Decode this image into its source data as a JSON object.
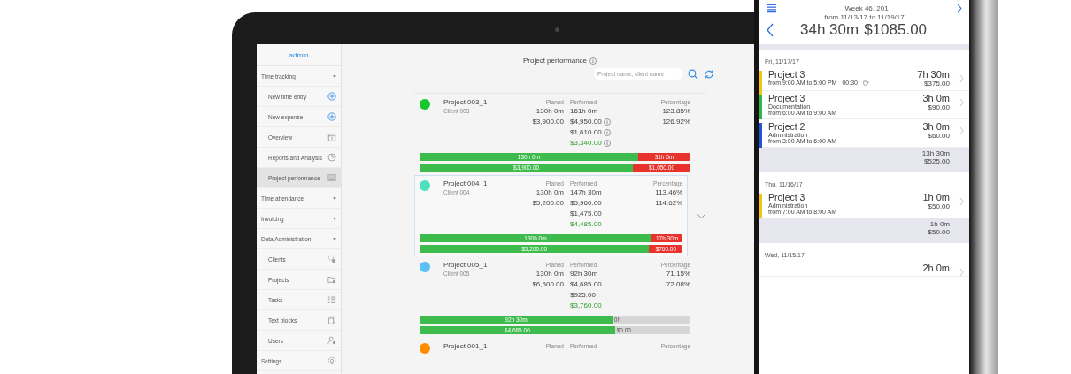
{
  "sidebar": {
    "user": "admin",
    "items": [
      {
        "label": "Time tracking",
        "kind": "group",
        "children": [
          {
            "label": "New time entry",
            "selected": false
          },
          {
            "label": "New expense",
            "selected": false
          },
          {
            "label": "Overview",
            "selected": false
          },
          {
            "label": "Reports and Analysis",
            "selected": false
          },
          {
            "label": "Project performance",
            "selected": true
          }
        ]
      },
      {
        "label": "Time attendance",
        "kind": "group"
      },
      {
        "label": "Invoicing",
        "kind": "group"
      },
      {
        "label": "Data Administration",
        "kind": "group",
        "children": [
          {
            "label": "Clients",
            "selected": false
          },
          {
            "label": "Projects",
            "selected": false
          },
          {
            "label": "Tasks",
            "selected": false
          },
          {
            "label": "Text blocks",
            "selected": false
          },
          {
            "label": "Users",
            "selected": false
          }
        ]
      },
      {
        "label": "Settings",
        "kind": "link"
      }
    ]
  },
  "main": {
    "title": "Project performance",
    "search": {
      "placeholder": "Project name, client name"
    },
    "projects": [
      {
        "name": "Project 003_1",
        "client": "Client 003",
        "color": "#16c72e",
        "selected": false,
        "headers": [
          "Planed",
          "Performed",
          "Percentage"
        ],
        "planned": [
          "130h 0m",
          "$3,900.00"
        ],
        "performed": [
          {
            "text": "161h 0m",
            "kind": "plain",
            "info": false
          },
          {
            "text": "$4,950.00",
            "kind": "plain",
            "info": true
          },
          {
            "text": "$1,610.00",
            "kind": "plain",
            "info": true
          },
          {
            "text": "$3,340.00",
            "kind": "profit",
            "info": true
          }
        ],
        "percentages": [
          "123.85%",
          "126.92%"
        ],
        "bars": [
          {
            "filled": "130h 0m",
            "rest": "31h 0m",
            "level": 0.807,
            "kind": "over"
          },
          {
            "filled": "$3,900.00",
            "rest": "$1,050.00",
            "level": 0.788,
            "kind": "over"
          }
        ]
      },
      {
        "name": "Project 004_1",
        "client": "Client 004",
        "color": "#4fe0c0",
        "selected": true,
        "headers": [
          "Planed",
          "Performed",
          "Percentage"
        ],
        "planned": [
          "130h 0m",
          "$5,200.00"
        ],
        "performed": [
          {
            "text": "147h 30m",
            "kind": "plain",
            "info": false
          },
          {
            "text": "$5,960.00",
            "kind": "plain",
            "info": false
          },
          {
            "text": "$1,475.00",
            "kind": "plain",
            "info": false
          },
          {
            "text": "$4,485.00",
            "kind": "profit",
            "info": false
          }
        ],
        "percentages": [
          "113.46%",
          "114.62%"
        ],
        "bars": [
          {
            "filled": "130h 0m",
            "rest": "17h 30m",
            "level": 0.881,
            "kind": "over"
          },
          {
            "filled": "$5,200.00",
            "rest": "$760.00",
            "level": 0.872,
            "kind": "over"
          }
        ]
      },
      {
        "name": "Project 005_1",
        "client": "Client 005",
        "color": "#5bc0f5",
        "selected": false,
        "headers": [
          "Planed",
          "Performed",
          "Percentage"
        ],
        "planned": [
          "130h 0m",
          "$6,500.00"
        ],
        "performed": [
          {
            "text": "92h 30m",
            "kind": "plain",
            "info": false
          },
          {
            "text": "$4,685.00",
            "kind": "plain",
            "info": false
          },
          {
            "text": "$925.00",
            "kind": "plain",
            "info": false
          },
          {
            "text": "$3,760.00",
            "kind": "profit",
            "info": false
          }
        ],
        "percentages": [
          "71.15%",
          "72.08%"
        ],
        "bars": [
          {
            "filled": "92h 30m",
            "rest": "0h",
            "level": 0.712,
            "kind": "under"
          },
          {
            "filled": "$4,685.00",
            "rest": "$0.00",
            "level": 0.721,
            "kind": "under"
          }
        ]
      },
      {
        "name": "Project 001_1",
        "color": "#ff8c00",
        "selected": false,
        "headers": [
          "Planed",
          "Performed",
          "Percentage"
        ]
      }
    ]
  },
  "phone": {
    "week": "Week 46, 201",
    "range": "from 11/13/17 to 11/19/17",
    "total_time": "34h 30m",
    "total_amount": "$1085.00",
    "days": [
      {
        "date": "Fri, 11/17/17",
        "entries": [
          {
            "project": "Project 3",
            "time": "from 9:00 AM to 5:00 PM",
            "pause": "00:30",
            "duration": "7h 30m",
            "amount": "$375.00",
            "color": "#f0c419"
          },
          {
            "project": "Project 3",
            "task": "Documentation",
            "time": "from 6:00 AM to 9:00 AM",
            "duration": "3h 0m",
            "amount": "$90.00",
            "color": "#2fb84a"
          },
          {
            "project": "Project 2",
            "task": "Administration",
            "time": "from 3:00 AM to 6:00 AM",
            "duration": "3h 0m",
            "amount": "$60.00",
            "color": "#1f55d6"
          }
        ],
        "total_time": "13h 30m",
        "total_amount": "$525.00"
      },
      {
        "date": "Thu, 11/16/17",
        "entries": [
          {
            "project": "Project 3",
            "task": "Administration",
            "time": "from 7:00 AM to 8:00 AM",
            "duration": "1h 0m",
            "amount": "$50.00",
            "color": "#f0c419"
          }
        ],
        "total_time": "1h 0m",
        "total_amount": "$50.00"
      },
      {
        "date": "Wed, 11/15/17",
        "entries": [
          {
            "duration": "2h 0m"
          }
        ]
      }
    ]
  }
}
